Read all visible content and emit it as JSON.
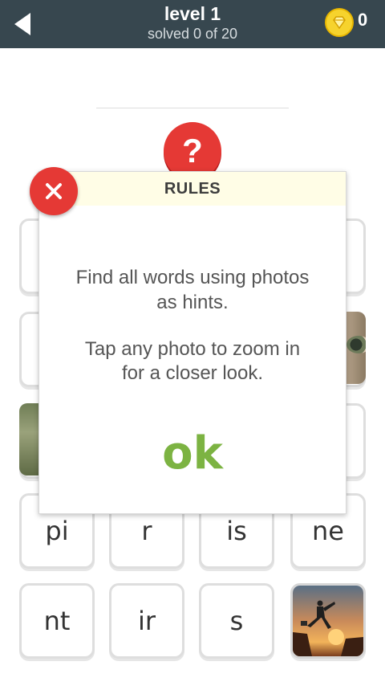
{
  "header": {
    "title": "level 1",
    "subtitle": "solved 0 of 20",
    "coins": "0",
    "back_icon": "back-arrow-icon",
    "coin_icon": "diamond-coin-icon"
  },
  "hint": {
    "label": "?"
  },
  "tiles_row5": [
    "pi",
    "r",
    "is",
    "ne"
  ],
  "tiles_row6": [
    "nt",
    "ir",
    "s"
  ],
  "modal": {
    "title": "RULES",
    "line1": "Find all words using photos",
    "line2": "as hints.",
    "line3": "Tap any photo to zoom in",
    "line4": "for a closer look.",
    "ok": "ok",
    "close_icon": "close-icon"
  },
  "colors": {
    "header": "#37474f",
    "accent_red": "#e53935",
    "ok_green": "#7cb342",
    "coin": "#f6d32d"
  }
}
